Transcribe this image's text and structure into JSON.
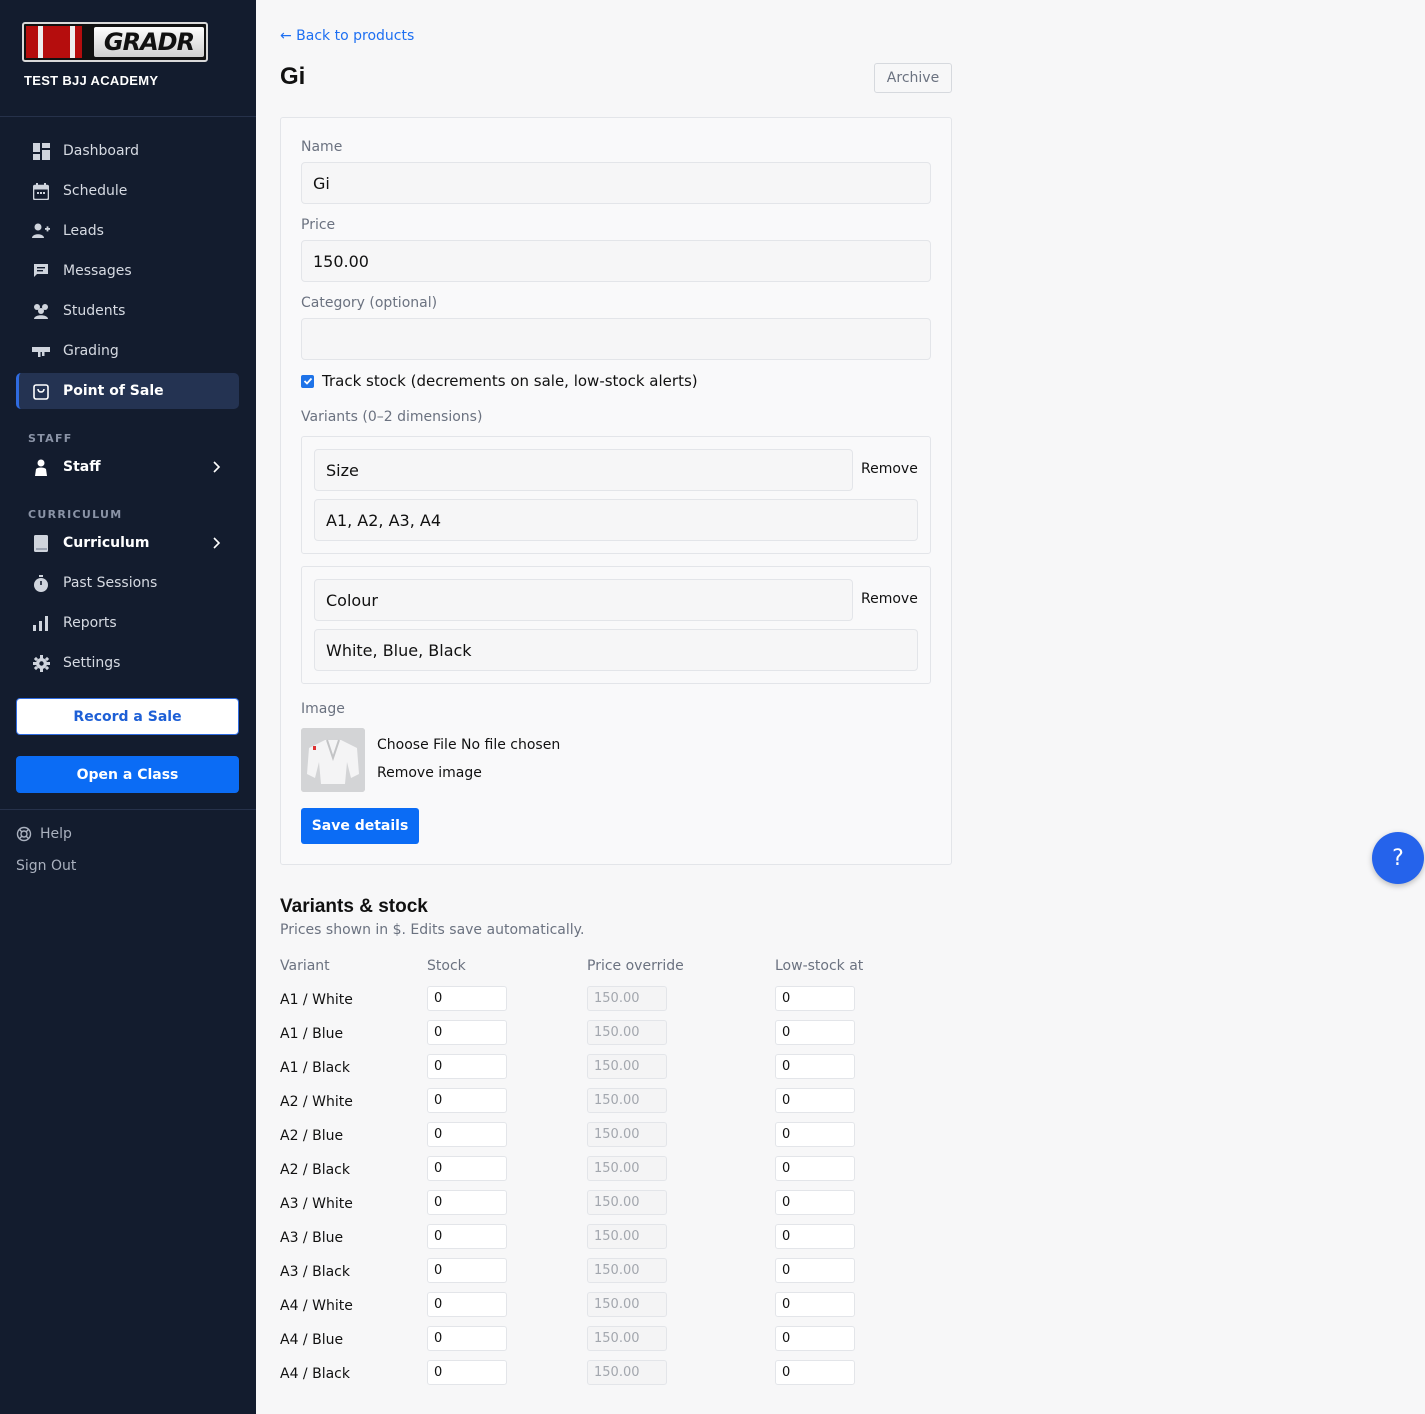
{
  "sidebar": {
    "logo_text": "GRADR",
    "academy_name": "TEST BJJ ACADEMY",
    "nav": [
      {
        "label": "Dashboard",
        "icon": "dashboard-icon"
      },
      {
        "label": "Schedule",
        "icon": "calendar-icon"
      },
      {
        "label": "Leads",
        "icon": "add-person-icon"
      },
      {
        "label": "Messages",
        "icon": "chat-icon"
      },
      {
        "label": "Students",
        "icon": "group-icon"
      },
      {
        "label": "Grading",
        "icon": "belt-icon"
      },
      {
        "label": "Point of Sale",
        "icon": "shopping-bag-icon",
        "active": true
      }
    ],
    "staff_section": "STAFF",
    "staff_item": "Staff",
    "curriculum_section": "CURRICULUM",
    "curriculum_items": [
      {
        "label": "Curriculum",
        "icon": "book-icon"
      },
      {
        "label": "Past Sessions",
        "icon": "stopwatch-icon"
      },
      {
        "label": "Reports",
        "icon": "bar-chart-icon"
      },
      {
        "label": "Settings",
        "icon": "gear-icon"
      }
    ],
    "record_sale": "Record a Sale",
    "open_class": "Open a Class",
    "help": "Help",
    "sign_out": "Sign Out"
  },
  "header": {
    "back_link": "← Back to products",
    "title": "Gi",
    "archive_button": "Archive"
  },
  "form": {
    "name_label": "Name",
    "name_value": "Gi",
    "price_label": "Price",
    "price_value": "150.00",
    "category_label": "Category (optional)",
    "category_value": "",
    "track_stock_label": "Track stock (decrements on sale, low-stock alerts)",
    "track_stock_checked": true,
    "variants_label": "Variants (0–2 dimensions)",
    "variants": [
      {
        "name": "Size",
        "values": "A1, A2, A3, A4",
        "remove": "Remove"
      },
      {
        "name": "Colour",
        "values": "White, Blue, Black",
        "remove": "Remove"
      }
    ],
    "image_label": "Image",
    "file_status": "Choose File No file chosen",
    "remove_image": "Remove image",
    "save_button": "Save details"
  },
  "variants_stock": {
    "title": "Variants & stock",
    "subtitle": "Prices shown in $. Edits save automatically.",
    "columns": [
      "Variant",
      "Stock",
      "Price override",
      "Low-stock at"
    ],
    "rows": [
      {
        "variant": "A1 / White",
        "stock": "0",
        "price": "150.00",
        "low": "0"
      },
      {
        "variant": "A1 / Blue",
        "stock": "0",
        "price": "150.00",
        "low": "0"
      },
      {
        "variant": "A1 / Black",
        "stock": "0",
        "price": "150.00",
        "low": "0"
      },
      {
        "variant": "A2 / White",
        "stock": "0",
        "price": "150.00",
        "low": "0"
      },
      {
        "variant": "A2 / Blue",
        "stock": "0",
        "price": "150.00",
        "low": "0"
      },
      {
        "variant": "A2 / Black",
        "stock": "0",
        "price": "150.00",
        "low": "0"
      },
      {
        "variant": "A3 / White",
        "stock": "0",
        "price": "150.00",
        "low": "0"
      },
      {
        "variant": "A3 / Blue",
        "stock": "0",
        "price": "150.00",
        "low": "0"
      },
      {
        "variant": "A3 / Black",
        "stock": "0",
        "price": "150.00",
        "low": "0"
      },
      {
        "variant": "A4 / White",
        "stock": "0",
        "price": "150.00",
        "low": "0"
      },
      {
        "variant": "A4 / Blue",
        "stock": "0",
        "price": "150.00",
        "low": "0"
      },
      {
        "variant": "A4 / Black",
        "stock": "0",
        "price": "150.00",
        "low": "0"
      }
    ]
  },
  "help_fab": "?",
  "colors": {
    "sidebar_bg": "#131c2e",
    "primary": "#0b6cf5",
    "active_nav": "#243352",
    "link": "#1d6ff2"
  }
}
